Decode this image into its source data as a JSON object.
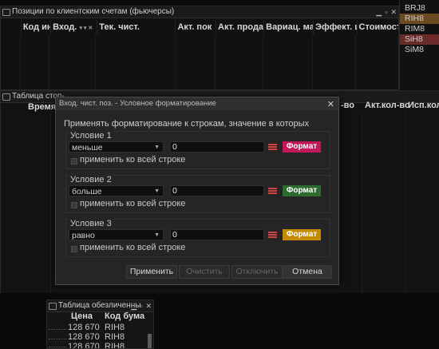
{
  "positions_window": {
    "title": "Позиции по клиентским счетам (фьючерсы)",
    "columns": [
      "Код ин",
      "Вход.",
      "Тек. чист.",
      "Акт. пок",
      "Акт. прода",
      "Вариац. мар",
      "Эффект. ц",
      "Стоимость поз"
    ],
    "sort_icons": "▾ ▾ ✕"
  },
  "side_list": {
    "items": [
      "BRJ8",
      "RIH8",
      "RIM8",
      "SiH8",
      "SiM8"
    ],
    "colors": {
      "RIH8": "#6b4a22",
      "SiH8": "#6a2a2a"
    }
  },
  "stop_window": {
    "title": "Таблица стоп-",
    "columns_left": [
      "Время"
    ],
    "columns_right": [
      "-во",
      "Акт.кол-во",
      "Исп.кол"
    ]
  },
  "dialog": {
    "title": "Вход. чист. поз. - Условное форматирование",
    "close": "✕",
    "description": "Применять форматирование к строкам, значение в которых",
    "conditions": [
      {
        "label": "Условие 1",
        "operator": "меньше",
        "value": "0",
        "format_label": "Формат",
        "format_color": "#c2185b",
        "apply_row": "применить ко всей строке"
      },
      {
        "label": "Условие 2",
        "operator": "больше",
        "value": "0",
        "format_label": "Формат",
        "format_color": "#2e6b2e",
        "apply_row": "применить ко всей строке"
      },
      {
        "label": "Условие 3",
        "operator": "равно",
        "value": "0",
        "format_label": "Формат",
        "format_color": "#c38a00",
        "apply_row": "применить ко всей строке"
      }
    ],
    "buttons": {
      "apply": "Применить",
      "clear": "Очистить",
      "disable": "Отключить",
      "cancel": "Отмена"
    }
  },
  "deals_window": {
    "title": "Таблица обезличенны",
    "columns": [
      "Цена",
      "Код бума"
    ],
    "rows": [
      {
        "price": "128 670",
        "code": "RIH8"
      },
      {
        "price": "128 670",
        "code": "RIH8"
      },
      {
        "price": "128 670",
        "code": "RIH8"
      }
    ]
  }
}
